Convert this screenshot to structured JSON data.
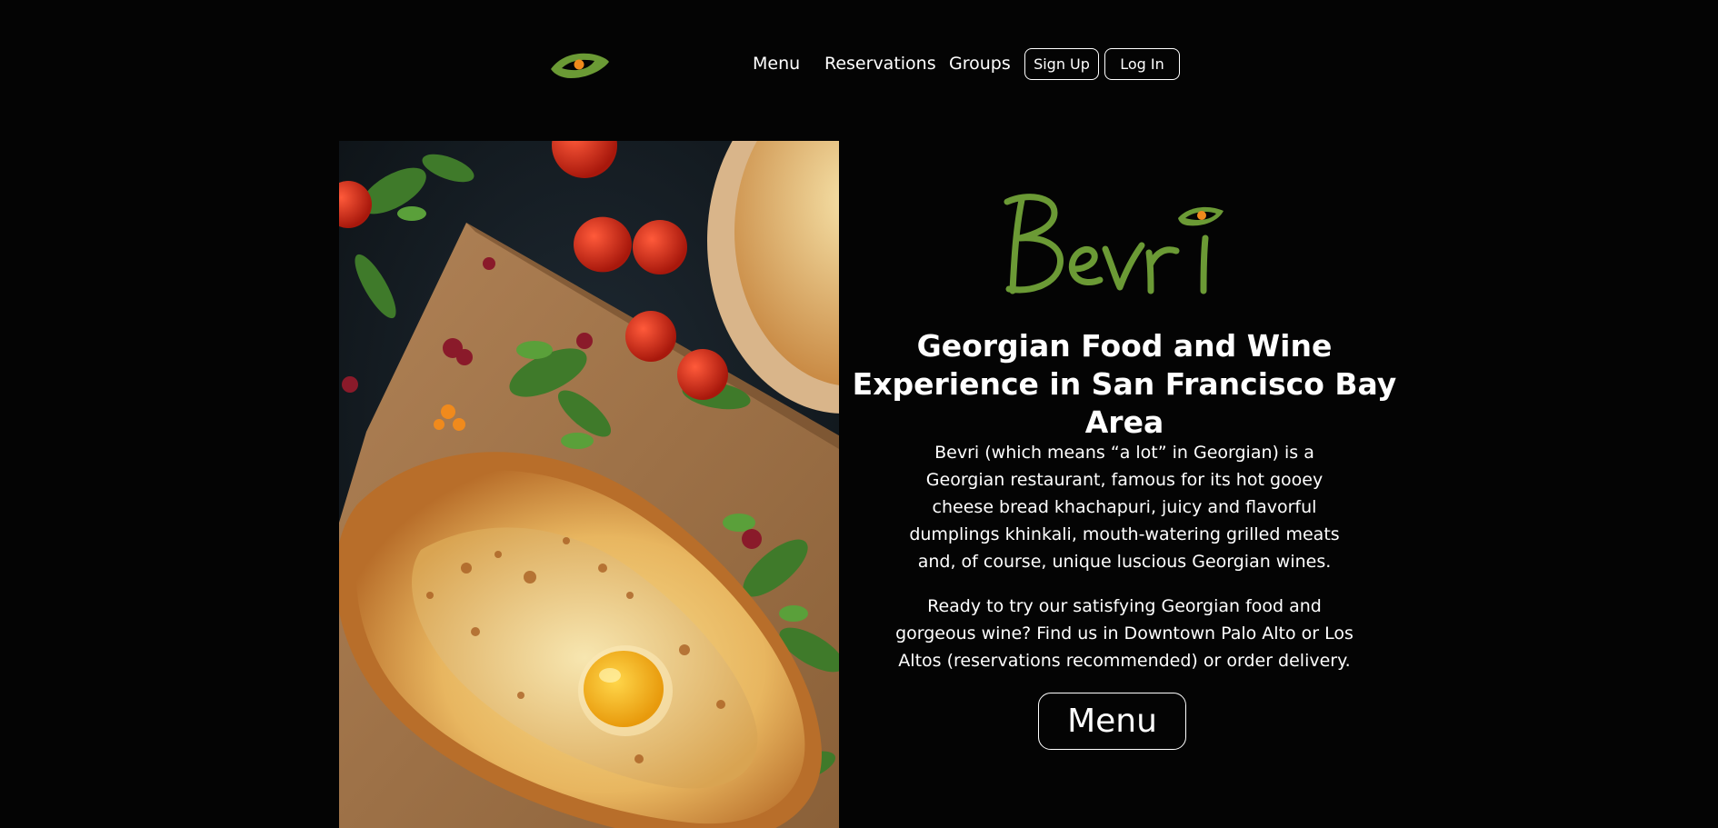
{
  "header": {
    "logo_icon": "eye-icon",
    "nav": {
      "menu": "Menu",
      "reservations": "Reservations",
      "groups": "Groups",
      "sign_up": "Sign Up",
      "log_in": "Log In"
    }
  },
  "hero": {
    "image": "khachapuri-photo",
    "brand_name": "Bevri",
    "headline": "Georgian Food and Wine Experience in San Francisco Bay Area",
    "paragraph_1": "Bevri (which means “a lot” in Georgian) is a Georgian restaurant, famous for its hot gooey cheese bread khachapuri, juicy and flavorful dumplings khinkali, mouth-watering grilled meats and, of course, unique luscious Georgian wines.",
    "paragraph_2": "Ready to try our satisfying Georgian food and gorgeous wine? Find us in Downtown Palo Alto or Los Altos (reservations recommended) or order delivery.",
    "cta_label": "Menu"
  },
  "colors": {
    "background": "#040404",
    "text": "#ffffff",
    "brand_green": "#6b9a35",
    "brand_orange": "#f08a1c"
  }
}
